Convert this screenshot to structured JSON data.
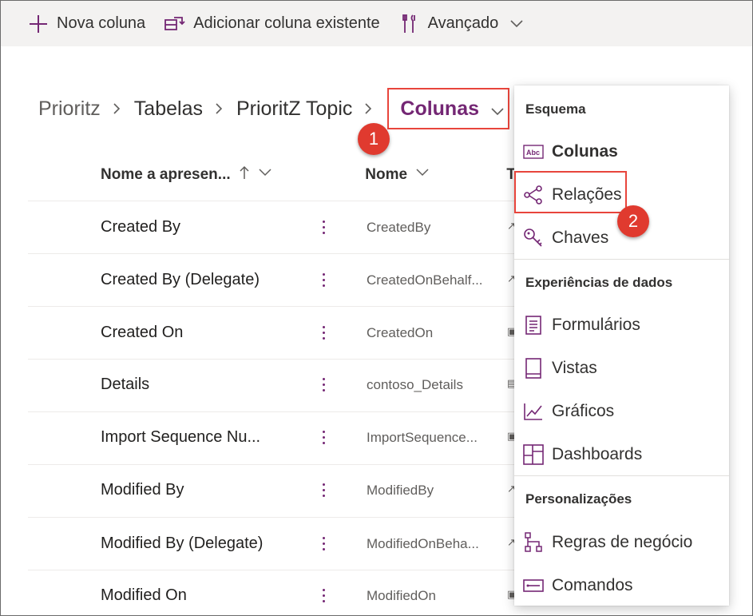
{
  "colors": {
    "accent": "#742774",
    "highlight": "#e8453c",
    "badge": "#e03a2f"
  },
  "commandbar": {
    "new_column": {
      "label": "Nova coluna",
      "icon": "plus-icon"
    },
    "add_existing": {
      "label": "Adicionar coluna existente",
      "icon": "add-existing-column-icon"
    },
    "advanced": {
      "label": "Avançado",
      "icon": "tools-icon"
    }
  },
  "breadcrumb": {
    "items": [
      "Prioritz",
      "Tabelas",
      "PrioritZ Topic"
    ],
    "current": "Colunas"
  },
  "badges": {
    "one": "1",
    "two": "2"
  },
  "table": {
    "headers": {
      "display_name": "Nome a apresen...",
      "name": "Nome",
      "type_partial": "T"
    },
    "rows": [
      {
        "display": "Created By",
        "logical": "CreatedBy"
      },
      {
        "display": "Created By (Delegate)",
        "logical": "CreatedOnBehalf..."
      },
      {
        "display": "Created On",
        "logical": "CreatedOn"
      },
      {
        "display": "Details",
        "logical": "contoso_Details"
      },
      {
        "display": "Import Sequence Nu...",
        "logical": "ImportSequence..."
      },
      {
        "display": "Modified By",
        "logical": "ModifiedBy"
      },
      {
        "display": "Modified By (Delegate)",
        "logical": "ModifiedOnBeha..."
      },
      {
        "display": "Modified On",
        "logical": "ModifiedOn"
      }
    ]
  },
  "menu": {
    "sections": [
      {
        "title": "Esquema",
        "items": [
          {
            "label": "Colunas",
            "icon": "columns-abc-icon"
          },
          {
            "label": "Relações",
            "icon": "relationships-icon"
          },
          {
            "label": "Chaves",
            "icon": "key-icon"
          }
        ]
      },
      {
        "title": "Experiências de dados",
        "items": [
          {
            "label": "Formulários",
            "icon": "form-icon"
          },
          {
            "label": "Vistas",
            "icon": "view-icon"
          },
          {
            "label": "Gráficos",
            "icon": "chart-icon"
          },
          {
            "label": "Dashboards",
            "icon": "dashboard-icon"
          }
        ]
      },
      {
        "title": "Personalizações",
        "items": [
          {
            "label": "Regras de negócio",
            "icon": "business-rules-icon"
          },
          {
            "label": "Comandos",
            "icon": "commands-icon"
          }
        ]
      }
    ]
  }
}
